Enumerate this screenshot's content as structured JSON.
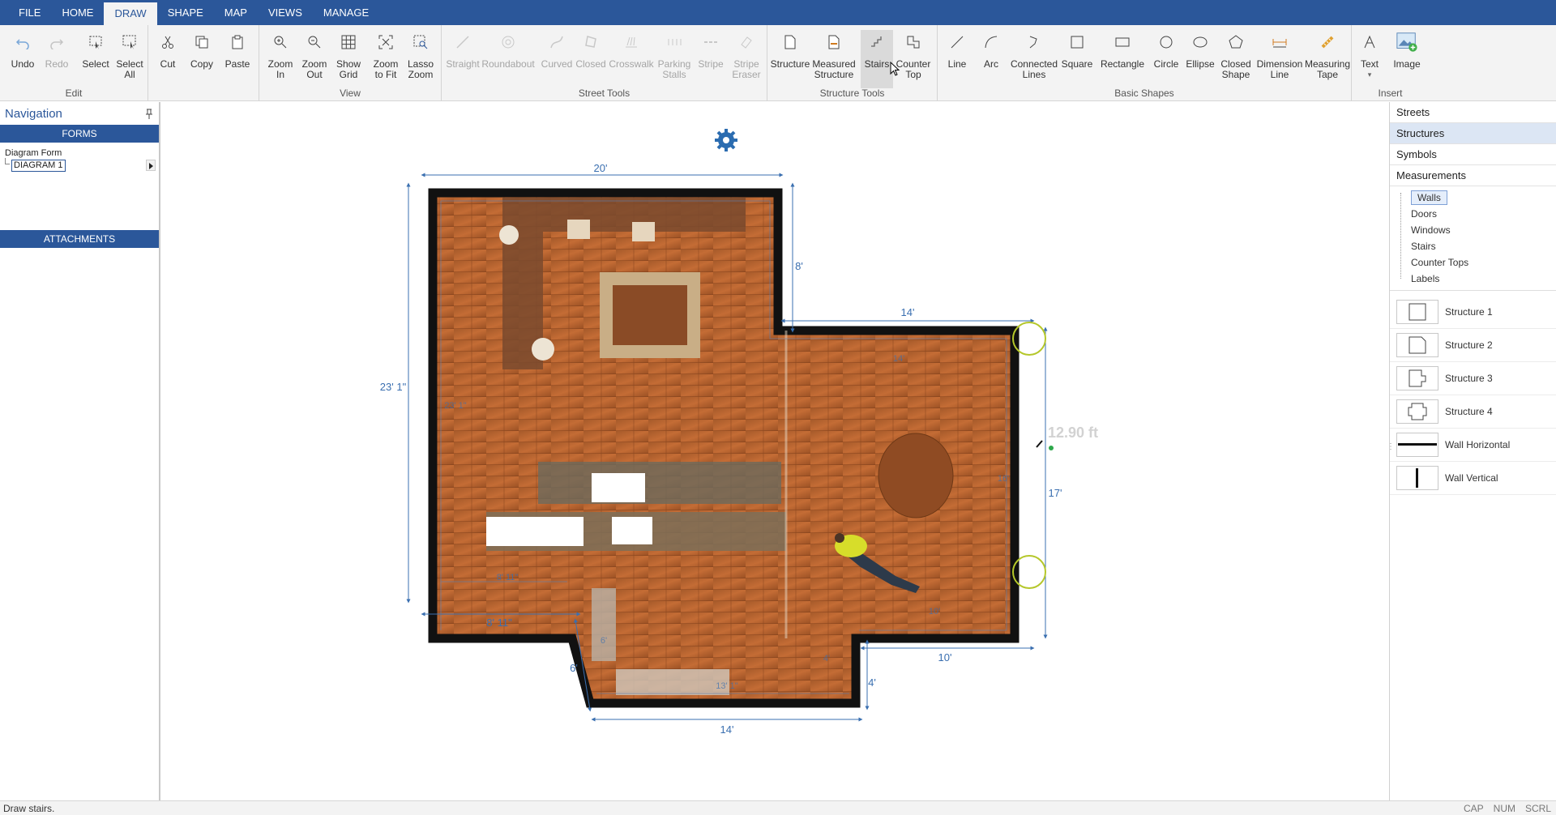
{
  "menu": {
    "tabs": [
      "FILE",
      "HOME",
      "DRAW",
      "SHAPE",
      "MAP",
      "VIEWS",
      "MANAGE"
    ],
    "active": "DRAW"
  },
  "ribbon": {
    "edit": {
      "label": "Edit",
      "undo": "Undo",
      "redo": "Redo",
      "select": "Select",
      "select_all": "Select\nAll",
      "cut": "Cut",
      "copy": "Copy",
      "paste": "Paste"
    },
    "view": {
      "label": "View",
      "zoom_in": "Zoom\nIn",
      "zoom_out": "Zoom\nOut",
      "show_grid": "Show\nGrid",
      "zoom_fit": "Zoom\nto Fit",
      "lasso": "Lasso\nZoom"
    },
    "street": {
      "label": "Street Tools",
      "straight": "Straight",
      "roundabout": "Roundabout",
      "curved": "Curved",
      "closed": "Closed",
      "crosswalk": "Crosswalk",
      "parking": "Parking\nStalls",
      "stripe": "Stripe",
      "stripe_eraser": "Stripe\nEraser"
    },
    "structure": {
      "label": "Structure Tools",
      "structure": "Structure",
      "measured": "Measured\nStructure",
      "stairs": "Stairs",
      "counter": "Counter\nTop"
    },
    "basic": {
      "label": "Basic Shapes",
      "line": "Line",
      "arc": "Arc",
      "connected": "Connected\nLines",
      "square": "Square",
      "rectangle": "Rectangle",
      "circle": "Circle",
      "ellipse": "Ellipse",
      "closed_shape": "Closed\nShape",
      "dimension": "Dimension\nLine",
      "tape": "Measuring\nTape"
    },
    "insert": {
      "label": "Insert",
      "text": "Text",
      "image": "Image"
    }
  },
  "navigation": {
    "title": "Navigation",
    "forms_header": "FORMS",
    "diagram_form_label": "Diagram Form",
    "diagram_value": "DIAGRAM 1",
    "attachments_header": "ATTACHMENTS"
  },
  "canvas": {
    "dims": {
      "top_width": "20'",
      "left_height": "23' 1\"",
      "inner_left": "23' 1\"",
      "right_notch": "8'",
      "top_right": "14'",
      "inner_top_right": "14'",
      "right_height": "17'",
      "inner_right": "16'",
      "bottom_right": "10'",
      "inner_bottom_right": "10'",
      "bottom_left": "8' 11\"",
      "inner_bottom_left": "8' 11\"",
      "diag": "6'",
      "bottom": "14'",
      "inner_bottom": "13' 1\"",
      "step": "4'",
      "inner_step": "4'",
      "inner_diag": "6'"
    },
    "measure_readout": "12.90 ft"
  },
  "right_panel": {
    "sections": [
      "Streets",
      "Structures",
      "Symbols",
      "Measurements"
    ],
    "selected_section": "Structures",
    "tree": [
      "Walls",
      "Doors",
      "Windows",
      "Stairs",
      "Counter Tops",
      "Labels"
    ],
    "tree_selected": "Walls",
    "symbols": [
      "Structure 1",
      "Structure 2",
      "Structure 3",
      "Structure 4",
      "Wall Horizontal",
      "Wall Vertical"
    ]
  },
  "status": {
    "message": "Draw stairs.",
    "indicators": [
      "CAP",
      "NUM",
      "SCRL"
    ]
  },
  "colors": {
    "accent": "#2b579a",
    "dimension": "#3a6fb0",
    "wall": "#111111",
    "floor": "#b4612c",
    "marker": "#b5c72a"
  }
}
